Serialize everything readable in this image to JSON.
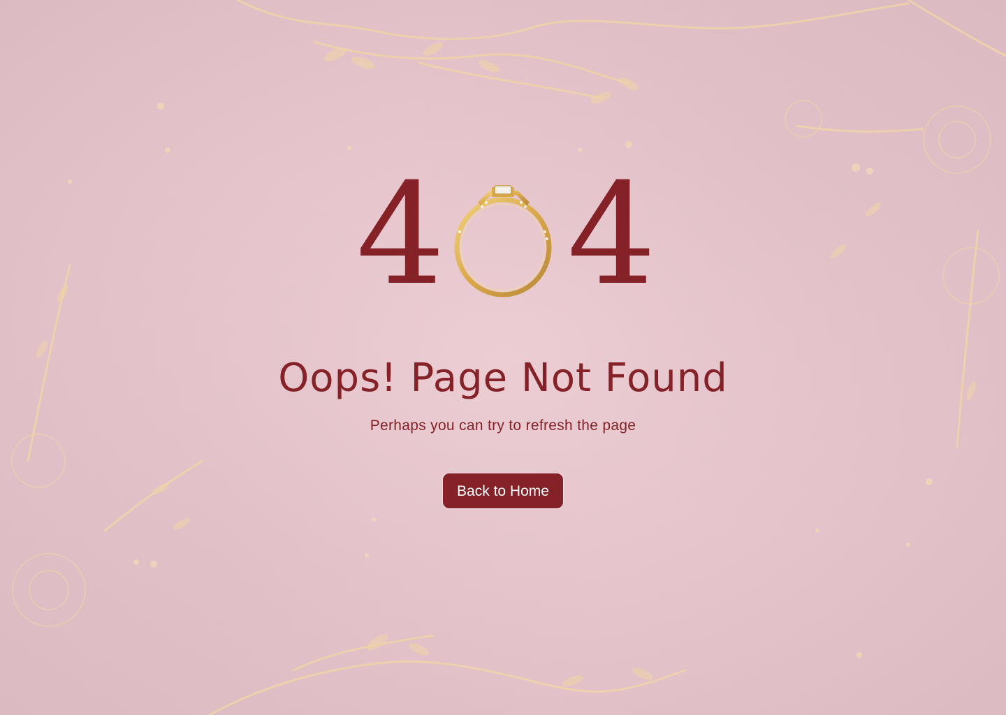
{
  "error": {
    "code_first_digit": "4",
    "code_last_digit": "4",
    "code_middle_icon": "ring-icon",
    "title": "Oops! Page Not Found",
    "message": "Perhaps you can try to refresh the page"
  },
  "actions": {
    "home_label": "Back to Home"
  },
  "colors": {
    "accent": "#842228",
    "background": "#e6c6cc",
    "gold": "#e8c79a",
    "button_text": "#ffffff"
  },
  "decor": {
    "background_icon": "floral-gold-pattern"
  }
}
